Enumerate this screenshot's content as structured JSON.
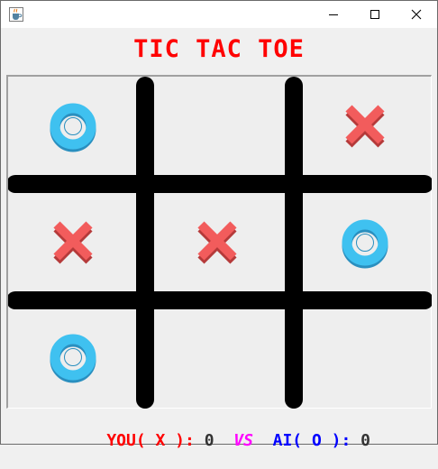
{
  "window": {
    "icon": "java-cup-icon",
    "controls": {
      "minimize": "minimize-icon",
      "maximize": "maximize-icon",
      "close": "close-icon"
    }
  },
  "game": {
    "title": "TIC TAC TOE",
    "cells": [
      {
        "row": 0,
        "col": 0,
        "mark": "O"
      },
      {
        "row": 0,
        "col": 1,
        "mark": ""
      },
      {
        "row": 0,
        "col": 2,
        "mark": "X"
      },
      {
        "row": 1,
        "col": 0,
        "mark": "X"
      },
      {
        "row": 1,
        "col": 1,
        "mark": "X"
      },
      {
        "row": 1,
        "col": 2,
        "mark": "O"
      },
      {
        "row": 2,
        "col": 0,
        "mark": "O"
      },
      {
        "row": 2,
        "col": 1,
        "mark": ""
      },
      {
        "row": 2,
        "col": 2,
        "mark": ""
      }
    ]
  },
  "score": {
    "you_label": "YOU( X ):",
    "you_value": "0",
    "vs_label": "VS",
    "ai_label": "AI( O ):",
    "ai_value": "0"
  },
  "colors": {
    "title": "#ff0000",
    "you": "#ff0000",
    "vs": "#ff00ff",
    "ai": "#0000ff",
    "score_value": "#333333",
    "x_mark": "#f25c5c",
    "o_mark": "#3fc1f0",
    "grid": "#000000"
  }
}
